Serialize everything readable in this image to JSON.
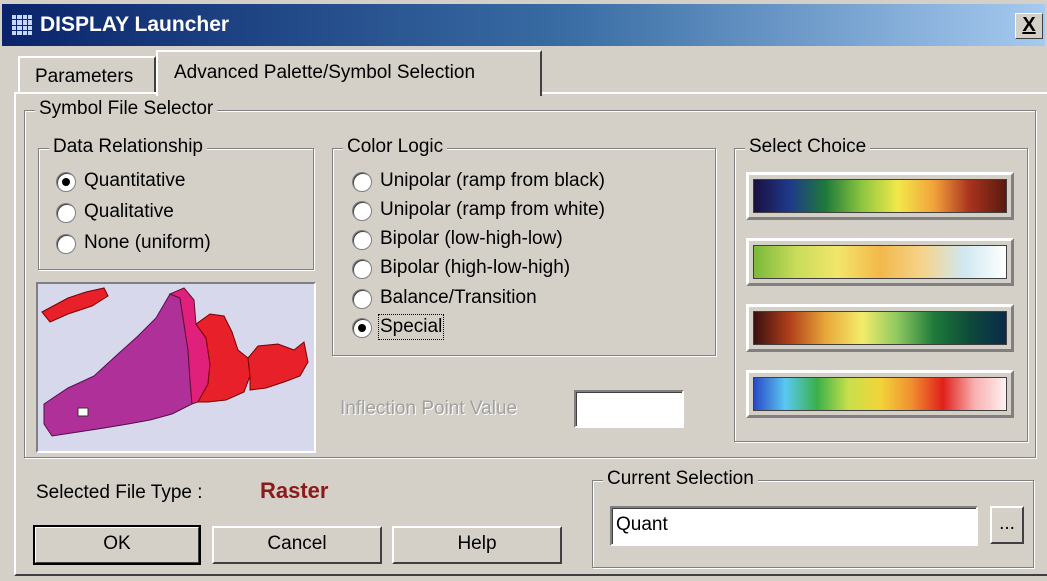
{
  "window": {
    "title": "DISPLAY Launcher",
    "close_label": "X"
  },
  "tabs": [
    {
      "label": "Parameters",
      "selected": false
    },
    {
      "label": "Advanced Palette/Symbol Selection",
      "selected": true
    }
  ],
  "symbol_file_selector": {
    "legend": "Symbol File Selector",
    "data_relationship": {
      "legend": "Data Relationship",
      "options": [
        {
          "label": "Quantitative",
          "checked": true
        },
        {
          "label": "Qualitative",
          "checked": false
        },
        {
          "label": "None (uniform)",
          "checked": false
        }
      ]
    },
    "color_logic": {
      "legend": "Color Logic",
      "options": [
        {
          "label": "Unipolar (ramp from black)",
          "checked": false
        },
        {
          "label": "Unipolar (ramp from white)",
          "checked": false
        },
        {
          "label": "Bipolar (low-high-low)",
          "checked": false
        },
        {
          "label": "Bipolar (high-low-high)",
          "checked": false
        },
        {
          "label": "Balance/Transition",
          "checked": false
        },
        {
          "label": "Special",
          "checked": true
        }
      ]
    },
    "inflection_point": {
      "label": "Inflection Point Value",
      "value": ""
    },
    "select_choice": {
      "legend": "Select Choice",
      "palettes": [
        {
          "name": "palette-1",
          "stops": [
            "#1a1040",
            "#1e3a8a",
            "#1f7a3a",
            "#8dc63f",
            "#f2e84a",
            "#f2a23a",
            "#a8321e",
            "#5a1a10"
          ]
        },
        {
          "name": "palette-2",
          "stops": [
            "#7ab83a",
            "#c9dc5a",
            "#f2e66a",
            "#f2b84a",
            "#f6d38a",
            "#cfe8f0",
            "#ffffff"
          ]
        },
        {
          "name": "palette-3",
          "stops": [
            "#3a1010",
            "#b2401a",
            "#e8a83a",
            "#f4ec6a",
            "#8cc860",
            "#1e7a3a",
            "#0e4a3a",
            "#0a2a4a"
          ]
        },
        {
          "name": "palette-4",
          "stops": [
            "#2a4ac8",
            "#5ac8f0",
            "#3ab04a",
            "#c8e04a",
            "#f2d43a",
            "#f09030",
            "#e0201a",
            "#f8b0b0",
            "#fff0f0"
          ]
        }
      ]
    }
  },
  "selected_file_type": {
    "label": "Selected File Type :",
    "value": "Raster",
    "color": "#8b1a1a"
  },
  "current_selection": {
    "legend": "Current Selection",
    "value": "Quant",
    "browse_label": "..."
  },
  "buttons": {
    "ok": "OK",
    "cancel": "Cancel",
    "help": "Help"
  },
  "colors": {
    "map_background": "#d8d8ec",
    "map_purple": "#b0309a",
    "map_magenta": "#e0207a",
    "map_red": "#e8202a"
  }
}
